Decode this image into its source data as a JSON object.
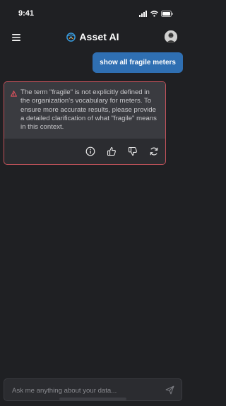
{
  "status_bar": {
    "time": "9:41"
  },
  "header": {
    "title": "Asset AI"
  },
  "conversation": {
    "user_message": "show all fragile meters",
    "ai_message": "The term \"fragile\" is not explicitly defined in the organization's vocabulary for meters. To ensure more accurate results, please provide a detailed clarification of what \"fragile\" means in this context."
  },
  "input": {
    "placeholder": "Ask me anything about your data..."
  },
  "colors": {
    "background": "#1f2023",
    "user_bubble": "#2f6fb2",
    "warning": "#e0525d",
    "brand_logo": "#3aa1e6"
  }
}
